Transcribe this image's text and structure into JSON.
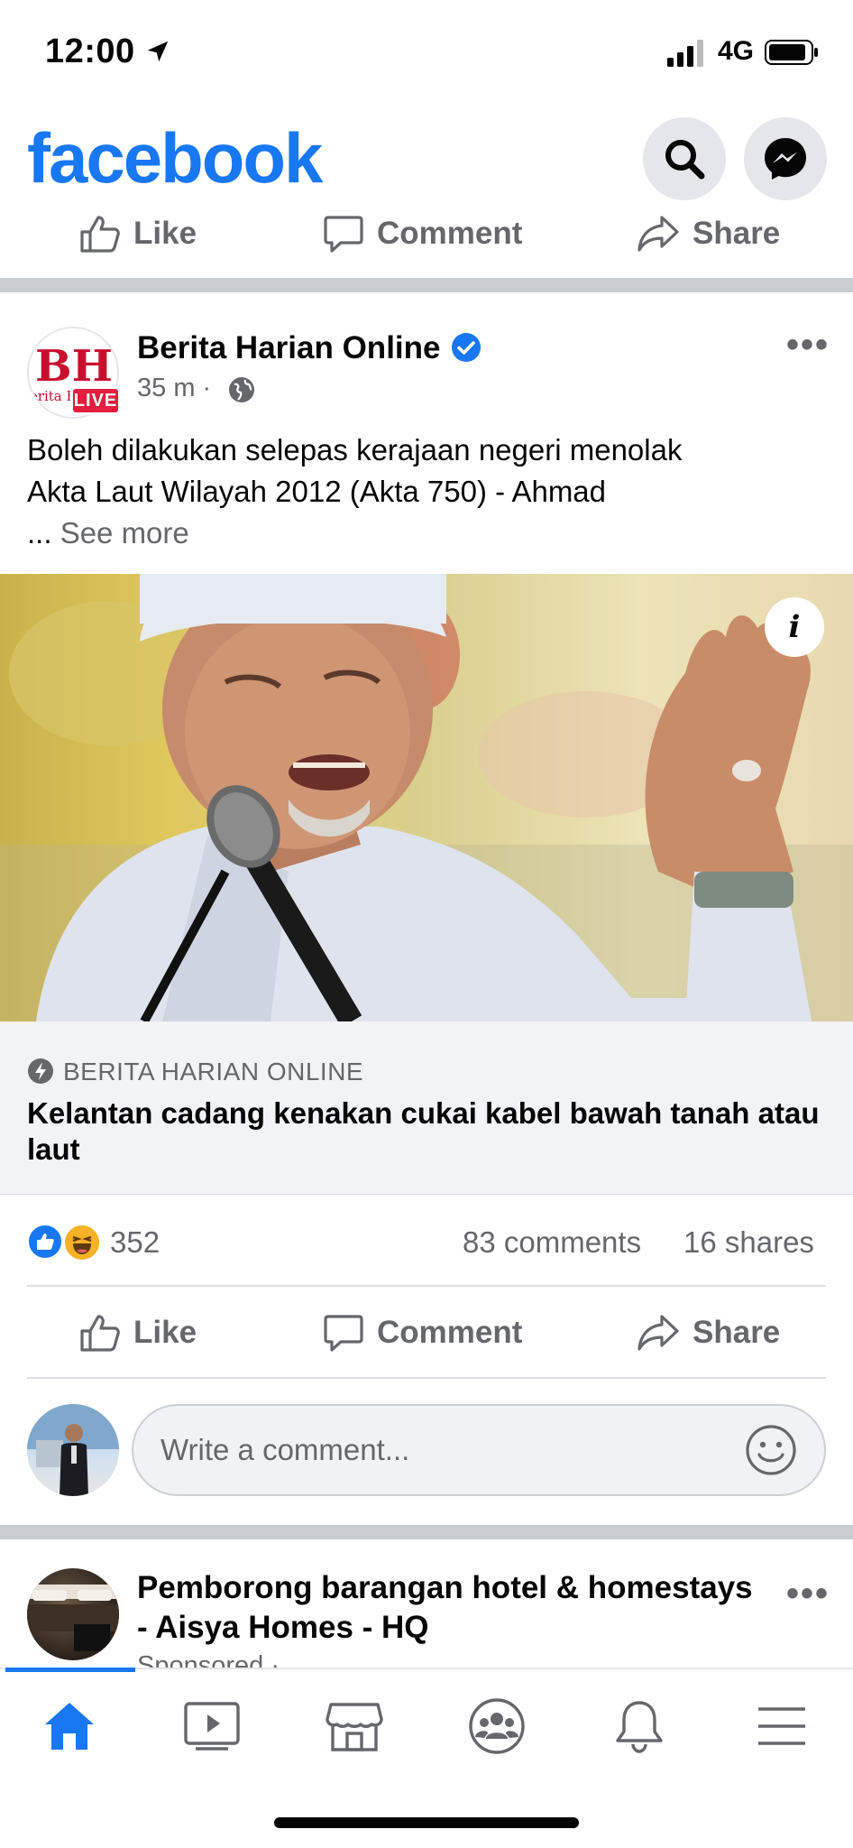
{
  "status_bar": {
    "time": "12:00",
    "network": "4G"
  },
  "header": {
    "logo": "facebook",
    "search_icon": "search-icon",
    "messenger_icon": "messenger-icon"
  },
  "top_actions": {
    "like": "Like",
    "comment": "Comment",
    "share": "Share"
  },
  "post": {
    "page_name": "Berita Harian Online",
    "avatar_text": "BH",
    "avatar_subtext": "Berita Harian",
    "live_badge": "LIVE",
    "time": "35 m",
    "separator": "·",
    "text_line1": "Boleh dilakukan selepas kerajaan negeri  menolak",
    "text_line2": "Akta Laut Wilayah 2012 (Akta 750) - Ahmad",
    "see_more_prefix": "...",
    "see_more": "See more",
    "info_label": "i",
    "link_source": "BERITA HARIAN ONLINE",
    "link_title": "Kelantan cadang kenakan cukai kabel bawah tanah atau laut",
    "reaction_count": "352",
    "comment_count": "83 comments",
    "share_count": "16 shares",
    "actions": {
      "like": "Like",
      "comment": "Comment",
      "share": "Share"
    },
    "comment_placeholder": "Write a comment..."
  },
  "next_post": {
    "page_name": "Pemborong barangan hotel & homestays - Aisya Homes - HQ",
    "sponsored": "Sponsored ·"
  },
  "tab_bar": {
    "tabs": [
      "home-icon",
      "watch-icon",
      "marketplace-icon",
      "groups-icon",
      "notifications-icon",
      "menu-icon"
    ],
    "active": "home-icon"
  },
  "colors": {
    "brand": "#1877f2",
    "secondary_text": "#65676b",
    "live_red": "#e41e3f",
    "divider": "#c9ccd1"
  }
}
